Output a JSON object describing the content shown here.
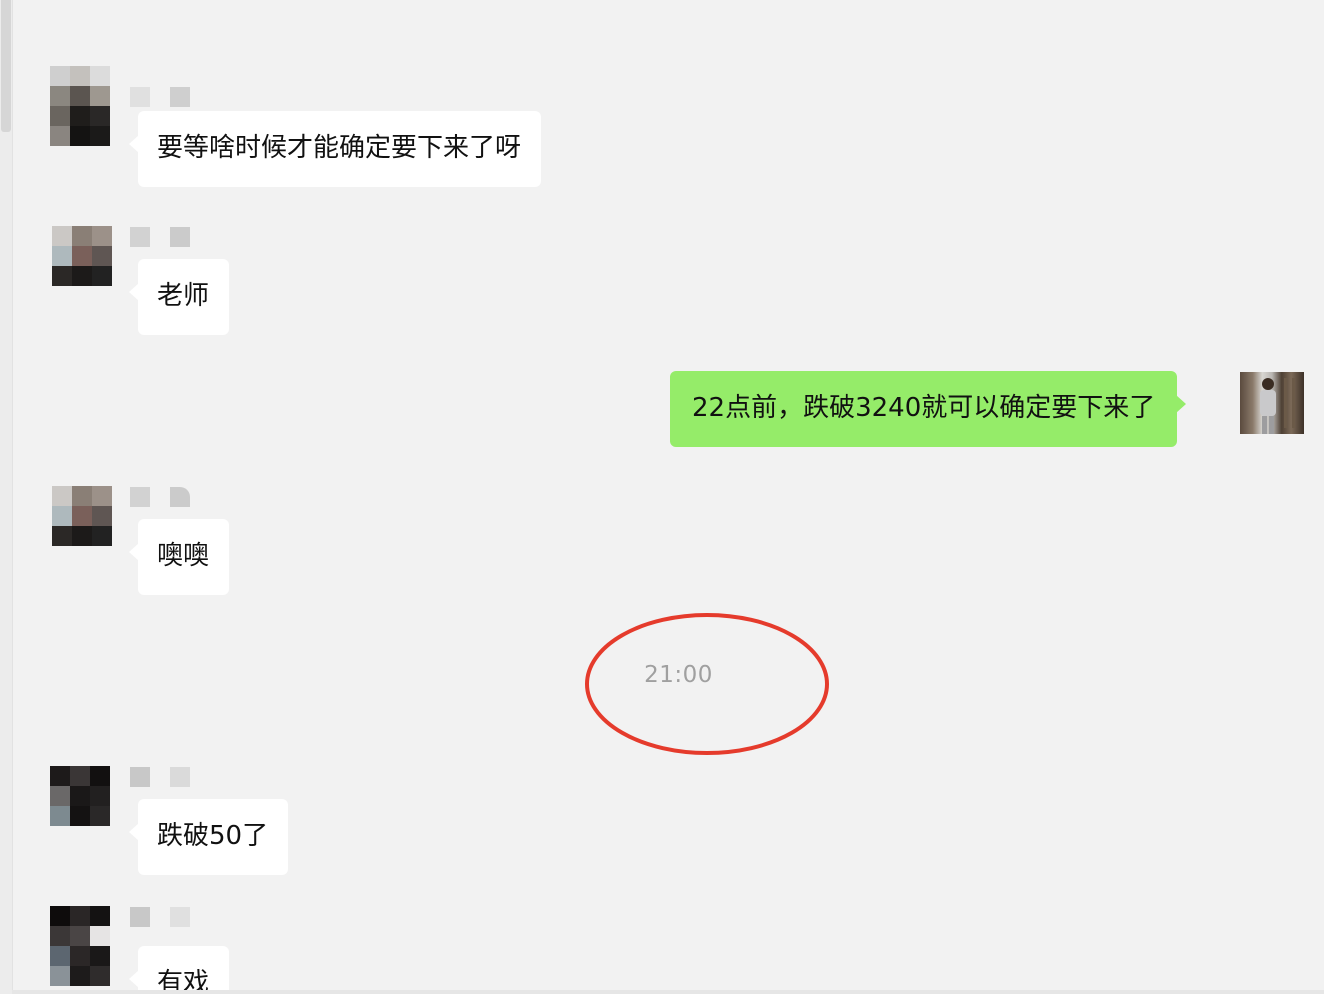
{
  "messages": [
    {
      "side": "left",
      "text": "要等啥时候才能确定要下来了呀"
    },
    {
      "side": "left",
      "text": "老师"
    },
    {
      "side": "right",
      "text": "22点前，跌破3240就可以确定要下来了"
    },
    {
      "side": "left",
      "text": "噢噢"
    },
    {
      "type": "time",
      "text": "21:00"
    },
    {
      "side": "left",
      "text": "跌破50了"
    },
    {
      "side": "left",
      "text": "有戏"
    }
  ],
  "annotation": {
    "shape": "ellipse",
    "color": "#e53b2c",
    "target": "timestamp"
  },
  "colors": {
    "background": "#f2f2f2",
    "bubble_other": "#ffffff",
    "bubble_self": "#95ec69",
    "timestamp": "#a0a0a0"
  },
  "icons": [
    "avatar-mosaic",
    "name-mosaic",
    "self-avatar-photo"
  ]
}
